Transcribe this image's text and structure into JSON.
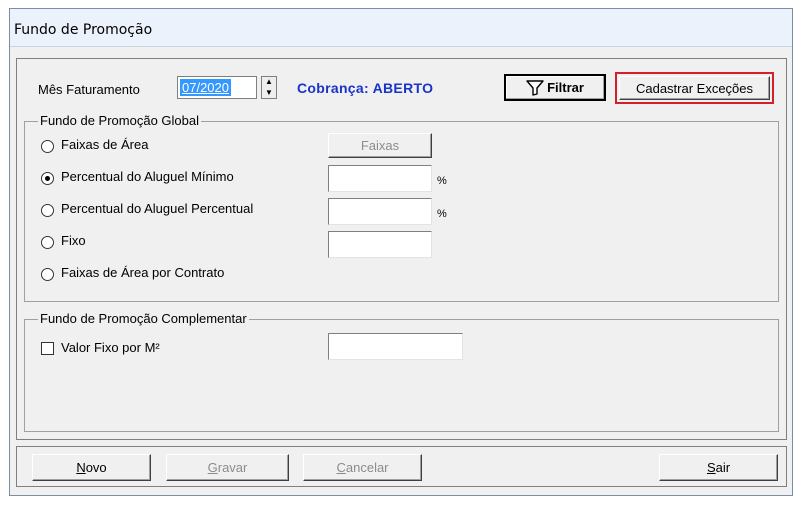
{
  "window": {
    "title": "Fundo de Promoção"
  },
  "header": {
    "mes_label": "Mês Faturamento",
    "mes_value": "07/2020",
    "status_text": "Cobrança: ABERTO",
    "filtrar_label": "Filtrar",
    "cadastrar_label": "Cadastrar Exceções"
  },
  "global": {
    "title": "Fundo de Promoção Global",
    "options": [
      {
        "label": "Faixas de Área",
        "checked": false
      },
      {
        "label": "Percentual do Aluguel Mínimo",
        "checked": true
      },
      {
        "label": "Percentual do Aluguel Percentual",
        "checked": false
      },
      {
        "label": "Fixo",
        "checked": false
      },
      {
        "label": "Faixas de Área por Contrato",
        "checked": false
      }
    ],
    "faixas_button": "Faixas",
    "pct_min_value": "",
    "pct_perc_value": "",
    "fixo_value": "",
    "percent_sign": "%"
  },
  "complementar": {
    "title": "Fundo de Promoção Complementar",
    "checkbox_label": "Valor Fixo por M²",
    "checked": false,
    "value": ""
  },
  "buttons": {
    "novo": {
      "accel": "N",
      "rest": "ovo"
    },
    "gravar": {
      "accel": "G",
      "rest": "ravar"
    },
    "cancelar": {
      "accel": "C",
      "rest": "ancelar"
    },
    "sair": {
      "accel": "S",
      "rest": "air"
    }
  }
}
